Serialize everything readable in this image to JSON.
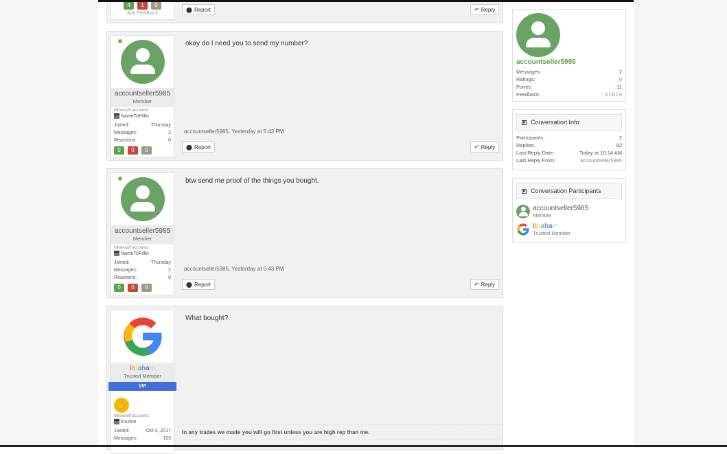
{
  "feedback_top": {
    "pos": "4",
    "neg": "1",
    "neu": "0",
    "add_label": "Add Feedback"
  },
  "buttons": {
    "report": "Report",
    "reply": "Reply"
  },
  "messages": [
    {
      "username": "accountseller5985",
      "user_title": "Member",
      "mc_label": "Minecraft accounts:",
      "mc_name": "NameToFillIn",
      "joined_label": "Joined:",
      "joined": "Thursday",
      "messages_label": "Messages:",
      "messages": "2",
      "reactions_label": "Reactions:",
      "reactions": "0",
      "ratings": [
        "0",
        "0",
        "0"
      ],
      "text": "okay do I need you to send my number?",
      "meta": "accountseller5985, Yesterday at 5:43 PM"
    },
    {
      "username": "accountseller5985",
      "user_title": "Member",
      "mc_label": "Minecraft accounts:",
      "mc_name": "NameToFillIn",
      "joined_label": "Joined:",
      "joined": "Thursday",
      "messages_label": "Messages:",
      "messages": "2",
      "reactions_label": "Reactions:",
      "reactions": "0",
      "ratings": [
        "0",
        "0",
        "0"
      ],
      "text": "btw send me proof of the things you bought.",
      "meta": "accountseller5985, Yesterday at 5:43 PM"
    },
    {
      "username": "Ibraham",
      "user_title": "Trusted Member",
      "badge": "VIP",
      "mc_label": "Minecraft accounts:",
      "mc_name": "knurkle",
      "joined_label": "Joined:",
      "joined": "Oct 3, 2017",
      "messages_label": "Messages:",
      "messages": "103",
      "text": "What bought?",
      "signature": "In any trades we made you will go first unless you are high rep than me."
    }
  ],
  "sidebar": {
    "profile": {
      "username": "accountseller5985",
      "messages_label": "Messages:",
      "messages": "2",
      "ratings_label": "Ratings:",
      "ratings": "0",
      "points_label": "Points:",
      "points": "11",
      "feedback_label": "Feedback:",
      "fb_pos": "0",
      "fb_neg": "0",
      "fb_neu": "0"
    },
    "info": {
      "title": "Conversation Info",
      "participants_label": "Participants:",
      "participants": "2",
      "replies_label": "Replies:",
      "replies": "92",
      "last_date_label": "Last Reply Date:",
      "last_date": "Today at 10:14 AM",
      "last_from_label": "Last Reply From:",
      "last_from": "accountseller5985"
    },
    "participants_panel": {
      "title": "Conversation Participants",
      "list": [
        {
          "name": "accountseller5985",
          "title": "Member"
        },
        {
          "name": "Ibraham",
          "title": "Trusted Member"
        }
      ]
    }
  },
  "colors": {
    "green": "#6aa364",
    "vip": "#3f6fd8",
    "link_green": "#5d9f4b"
  }
}
